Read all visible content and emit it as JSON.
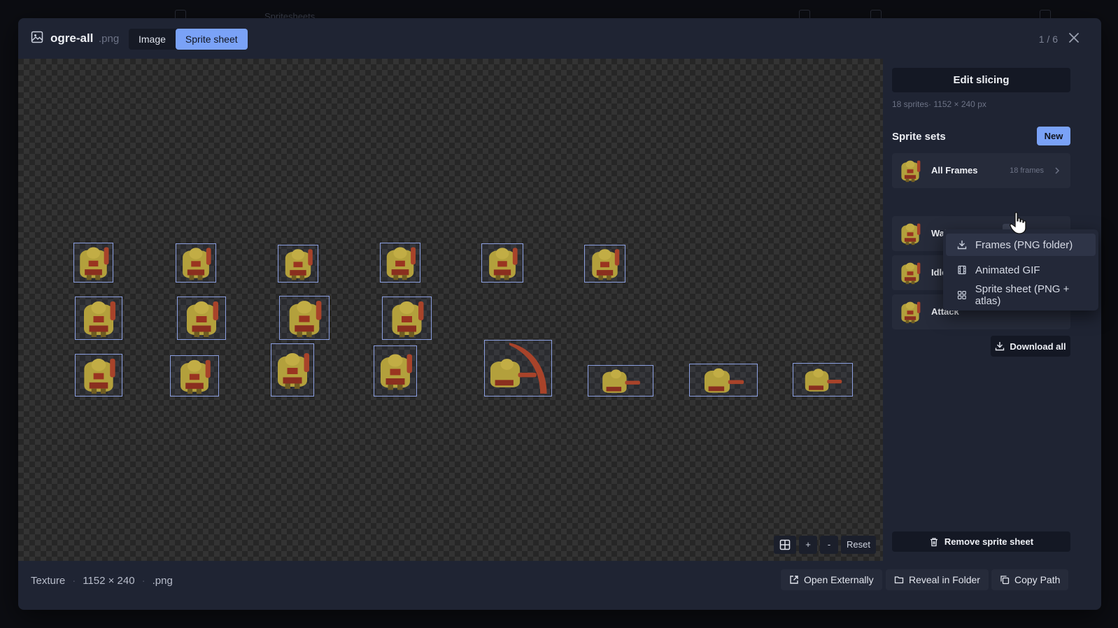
{
  "background_app": {
    "title": "Spritesheets"
  },
  "header": {
    "file_name": "ogre-all",
    "file_ext": ".png",
    "modes": [
      {
        "label": "Image",
        "active": false
      },
      {
        "label": "Sprite sheet",
        "active": true
      }
    ],
    "pager": "1 / 6"
  },
  "canvas": {
    "zoom_plus": "+",
    "zoom_minus": "-",
    "reset": "Reset"
  },
  "sidebar": {
    "edit_slicing": "Edit slicing",
    "meta": "18 sprites· 1152 × 240 px",
    "sets_title": "Sprite sets",
    "new_label": "New",
    "sets": [
      {
        "name": "All Frames",
        "count": "18 frames"
      },
      {
        "name": "Walk"
      },
      {
        "name": "Idle"
      },
      {
        "name": "Attack"
      }
    ],
    "download_all": "Download all",
    "remove_sheet": "Remove sprite sheet"
  },
  "export_menu": {
    "items": [
      {
        "label": "Frames (PNG folder)",
        "icon": "download-icon"
      },
      {
        "label": "Animated GIF",
        "icon": "film-icon"
      },
      {
        "label": "Sprite sheet (PNG + atlas)",
        "icon": "grid-icon"
      }
    ]
  },
  "footer": {
    "type": "Texture",
    "dimensions": "1152 × 240",
    "ext": ".png",
    "open_externally": "Open Externally",
    "reveal": "Reveal in Folder",
    "copy_path": "Copy Path"
  },
  "colors": {
    "accent": "#7aa2f7",
    "modal_bg": "#1f2433",
    "sprite_body": "#b3a03c",
    "sprite_club": "#a8432a"
  }
}
